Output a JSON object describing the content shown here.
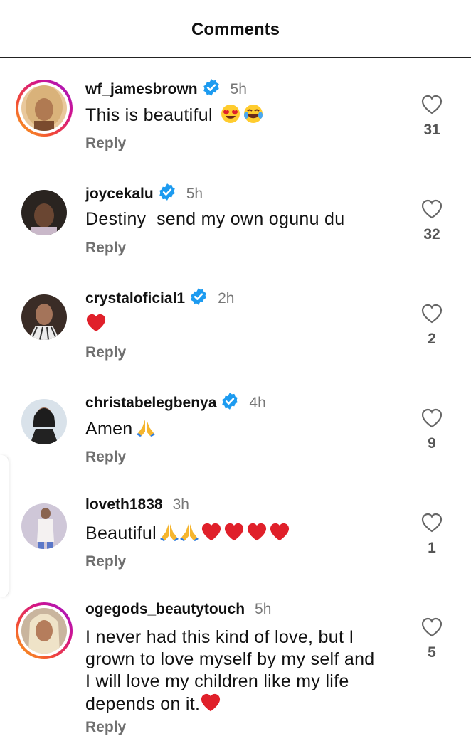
{
  "header": {
    "title": "Comments"
  },
  "comments": [
    {
      "username": "wf_jamesbrown",
      "verified": true,
      "time": "5h",
      "text": "This is beautiful",
      "emojis": [
        "heart-eyes-emoji",
        "joy-emoji"
      ],
      "reply_label": "Reply",
      "likes": "31",
      "story_ring": true
    },
    {
      "username": "joycekalu",
      "verified": true,
      "time": "5h",
      "text": "Destiny  send my own ogunu du",
      "emojis": [],
      "reply_label": "Reply",
      "likes": "32",
      "story_ring": false
    },
    {
      "username": "crystaloficial1",
      "verified": true,
      "time": "2h",
      "text": "",
      "emojis": [
        "red-heart-emoji"
      ],
      "reply_label": "Reply",
      "likes": "2",
      "story_ring": false
    },
    {
      "username": "christabelegbenya",
      "verified": true,
      "time": "4h",
      "text": "Amen",
      "emojis": [
        "folded-hands-emoji"
      ],
      "reply_label": "Reply",
      "likes": "9",
      "story_ring": false
    },
    {
      "username": "loveth1838",
      "verified": false,
      "time": "3h",
      "text": "Beautiful",
      "emojis": [
        "folded-hands-emoji",
        "folded-hands-emoji",
        "red-heart-emoji",
        "red-heart-emoji",
        "red-heart-emoji",
        "red-heart-emoji"
      ],
      "reply_label": "Reply",
      "likes": "1",
      "story_ring": false
    },
    {
      "username": "ogegods_beautytouch",
      "verified": false,
      "time": "5h",
      "text": "I never had this kind of love, but I grown to love myself by my self and I will love my children like my life depends on it.",
      "emojis": [
        "red-heart-emoji"
      ],
      "reply_label": "Reply",
      "likes": "5",
      "story_ring": true
    }
  ],
  "colors": {
    "verified": "#1d9bf0",
    "heart": "#e0202a",
    "muted": "#777777"
  },
  "icons": {
    "like": "heart-outline-icon",
    "verified": "verified-badge-icon"
  }
}
